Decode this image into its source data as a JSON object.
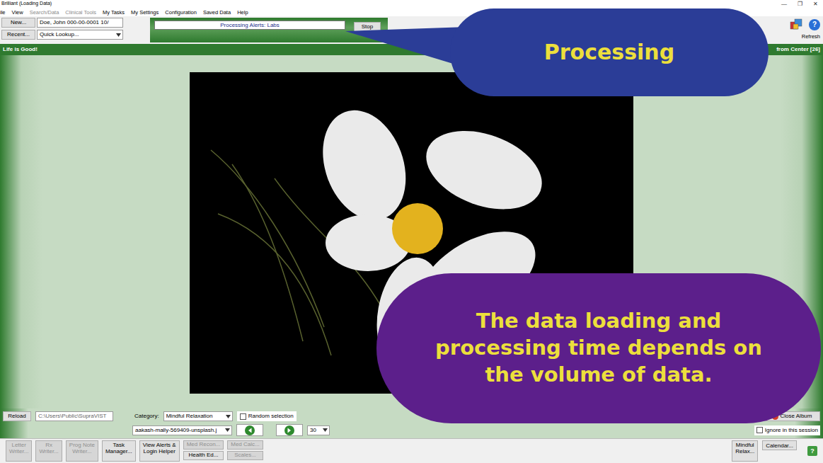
{
  "window": {
    "title": "Brilliant (Loading Data)",
    "controls": [
      "—",
      "❐",
      "✕"
    ]
  },
  "menu": [
    {
      "label": "ile",
      "disabled": false
    },
    {
      "label": "View",
      "disabled": false
    },
    {
      "label": "Search/Data",
      "disabled": true
    },
    {
      "label": "Clinical Tools",
      "disabled": true
    },
    {
      "label": "My Tasks",
      "disabled": false
    },
    {
      "label": "My Settings",
      "disabled": false
    },
    {
      "label": "Configuration",
      "disabled": false
    },
    {
      "label": "Saved Data",
      "disabled": false
    },
    {
      "label": "Help",
      "disabled": false
    }
  ],
  "toolbar": {
    "new_button": "New...",
    "patient": "Doe, John  000-00-0001  10/",
    "recent_button": "Recent...",
    "quick_lookup": "Quick Lookup...",
    "progress_label": "Processing Alerts: Labs",
    "stop_button": "Stop",
    "refresh_label": "Refresh",
    "help": "?"
  },
  "banner": {
    "message": "Life is Good!",
    "right": "from Center [26]"
  },
  "album": {
    "reload": "Reload",
    "path": "C:\\Users\\Public\\SupraVIST",
    "category_label": "Category:",
    "category": "Mindful Relaxation",
    "random": {
      "label": "Random selection",
      "checked": false
    },
    "file": "aakash-mally-569409-unsplash.j",
    "interval": "30",
    "close": "Close Album",
    "ignore": {
      "label": "Ignore in this session",
      "checked": false
    }
  },
  "tools": [
    {
      "kind": "tall",
      "lines": [
        "Letter",
        "Writer..."
      ],
      "disabled": true
    },
    {
      "kind": "tall",
      "lines": [
        "Rx",
        "Writer..."
      ],
      "disabled": true
    },
    {
      "kind": "tall",
      "lines": [
        "Prog Note",
        "Writer..."
      ],
      "disabled": true
    },
    {
      "kind": "tall",
      "lines": [
        "Task",
        "Manager..."
      ],
      "disabled": false
    },
    {
      "kind": "tall",
      "lines": [
        "View Alerts &",
        "Login Helper"
      ],
      "disabled": false
    },
    {
      "kind": "stack",
      "buttons": [
        {
          "label": "Med Recon...",
          "disabled": true
        },
        {
          "label": "Health Ed...",
          "disabled": false
        }
      ]
    },
    {
      "kind": "stack",
      "buttons": [
        {
          "label": "Med Calc...",
          "disabled": true
        },
        {
          "label": "Scales...",
          "disabled": true
        }
      ]
    }
  ],
  "right_tools": [
    {
      "kind": "tall",
      "lines": [
        "Mindful",
        "Relax..."
      ],
      "disabled": false
    },
    {
      "kind": "single",
      "lines": [
        "Calendar..."
      ],
      "disabled": false
    }
  ],
  "status_help": "?",
  "callouts": [
    {
      "text": "Processing"
    },
    {
      "text": "The data loading and processing time depends on the volume of data."
    }
  ]
}
